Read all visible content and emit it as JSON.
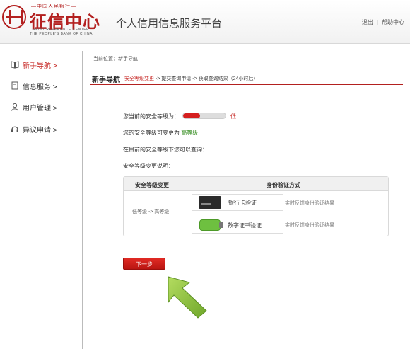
{
  "header": {
    "bank_line": "—中国人民银行—",
    "brand": "征信中心",
    "en_line1": "CREDIT REFERENCE CENTER",
    "en_line2": "THE PEOPLE'S BANK OF CHINA",
    "site_title": "个人信用信息服务平台",
    "logout": "退出",
    "separator": "|",
    "help": "帮助中心"
  },
  "sidebar": {
    "items": [
      {
        "label": "新手导航 >",
        "icon": "book-icon",
        "active": true
      },
      {
        "label": "信息服务 >",
        "icon": "document-icon",
        "active": false
      },
      {
        "label": "用户管理 >",
        "icon": "user-icon",
        "active": false
      },
      {
        "label": "异议申请 >",
        "icon": "headset-icon",
        "active": false
      }
    ]
  },
  "main": {
    "breadcrumb": "当前位置：新手导航",
    "title": "新手导航",
    "steps": {
      "current": "安全等级变更",
      "rest": " -> 提交查询申请 -> 获取查询结果（24小时后）"
    },
    "security_label": "您当前的安全等级为：",
    "security_level_fraction": 0.4,
    "security_word": "低",
    "changeable_prefix": "您的安全等级可变更为",
    "changeable_level": "高等级",
    "query_text": "在目前的安全等级下您可以查询：",
    "change_desc": "安全等级变更说明：",
    "table": {
      "col1": "安全等级变更",
      "col2": "身份验证方式",
      "change": "低等级 -> 高等级",
      "methods": [
        {
          "label": "银行卡验证",
          "note": "实时反馈身份验证结果"
        },
        {
          "label": "数字证书验证",
          "note": "实时反馈身份验证结果"
        }
      ]
    },
    "next_button": "下一步"
  },
  "colors": {
    "brand_red": "#b3201f",
    "accent_red": "#c5221f",
    "high_green": "#2f8a1a",
    "arrow_green": "#8cc43c"
  }
}
